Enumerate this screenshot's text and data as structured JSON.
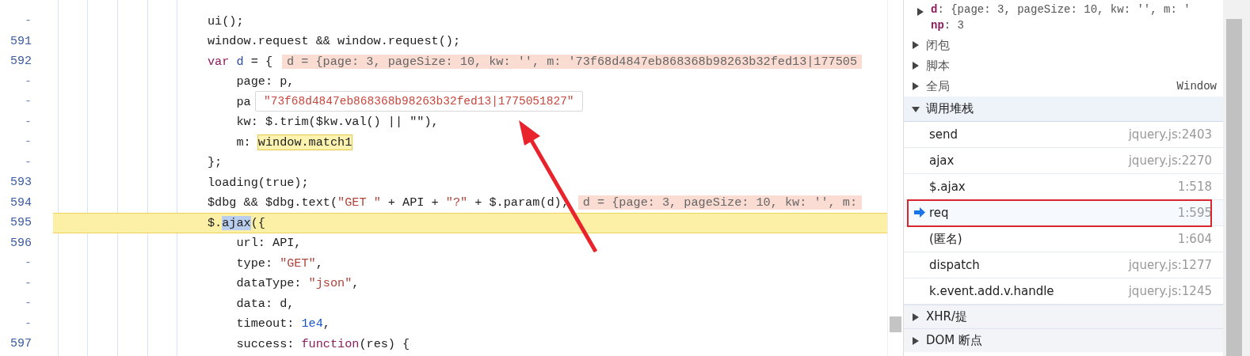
{
  "code_lines": [
    {
      "number": "-",
      "tokens": [
        {
          "text": "ui();",
          "kind": "plain"
        }
      ]
    },
    {
      "number": "591",
      "tokens": [
        {
          "text": "window.request && window.request();",
          "kind": "plain"
        }
      ]
    },
    {
      "number": "592",
      "tokens": [
        {
          "text": "var",
          "kind": "keyword"
        },
        {
          "text": " d",
          "kind": "variable"
        },
        {
          "text": " = {",
          "kind": "plain"
        }
      ],
      "inline_value": "d = {page: 3, pageSize: 10, kw: '', m: '73f68d4847eb868368b98263b32fed13|177505"
    },
    {
      "number": "-",
      "tokens": [
        {
          "text": "    page: p,",
          "kind": "plain"
        }
      ]
    },
    {
      "number": "-",
      "tokens": [
        {
          "text": "    pa",
          "kind": "plain"
        }
      ]
    },
    {
      "number": "-",
      "tokens": [
        {
          "text": "    kw: $.trim($kw.val() || \"\"),",
          "kind": "plain"
        }
      ]
    },
    {
      "number": "-",
      "tokens": [
        {
          "text": "    m: ",
          "kind": "plain"
        },
        {
          "text": "window.match1",
          "kind": "hovered"
        }
      ]
    },
    {
      "number": "-",
      "tokens": [
        {
          "text": "};",
          "kind": "plain"
        }
      ]
    },
    {
      "number": "593",
      "tokens": [
        {
          "text": "loading(true);",
          "kind": "plain"
        }
      ]
    },
    {
      "number": "594",
      "tokens": [
        {
          "text": "$dbg && $dbg.text(",
          "kind": "plain"
        },
        {
          "text": "\"GET \"",
          "kind": "string"
        },
        {
          "text": " + API + ",
          "kind": "plain"
        },
        {
          "text": "\"?\"",
          "kind": "string"
        },
        {
          "text": " + $.param(d);",
          "kind": "plain"
        }
      ],
      "inline_value": "d = {page: 3, pageSize: 10, kw: '', m:"
    },
    {
      "number": "595",
      "current": true,
      "tokens": [
        {
          "text": "$.",
          "kind": "plain"
        },
        {
          "text": "ajax",
          "kind": "selection"
        },
        {
          "text": "({",
          "kind": "plain"
        }
      ]
    },
    {
      "number": "596",
      "tokens": [
        {
          "text": "    url: API,",
          "kind": "plain"
        }
      ]
    },
    {
      "number": "-",
      "tokens": [
        {
          "text": "    type: ",
          "kind": "plain"
        },
        {
          "text": "\"GET\"",
          "kind": "string"
        },
        {
          "text": ",",
          "kind": "plain"
        }
      ]
    },
    {
      "number": "-",
      "tokens": [
        {
          "text": "    dataType: ",
          "kind": "plain"
        },
        {
          "text": "\"json\"",
          "kind": "string"
        },
        {
          "text": ",",
          "kind": "plain"
        }
      ]
    },
    {
      "number": "-",
      "tokens": [
        {
          "text": "    data: d,",
          "kind": "plain"
        }
      ]
    },
    {
      "number": "-",
      "tokens": [
        {
          "text": "    timeout: ",
          "kind": "plain"
        },
        {
          "text": "1e4",
          "kind": "number"
        },
        {
          "text": ",",
          "kind": "plain"
        }
      ]
    },
    {
      "number": "597",
      "tokens": [
        {
          "text": "    success: ",
          "kind": "plain"
        },
        {
          "text": "function",
          "kind": "keyword"
        },
        {
          "text": "(res) {",
          "kind": "plain"
        }
      ]
    }
  ],
  "tooltip": {
    "value": "\"73f68d4847eb868368b98263b32fed13|1775051827\""
  },
  "scope_vars": [
    {
      "name": "d",
      "value": ": {page: 3, pageSize: 10, kw: '', m: '",
      "kind": "object"
    },
    {
      "name": "np",
      "value": ": 3",
      "kind": "primitive"
    }
  ],
  "sections": [
    {
      "label": "闭包",
      "expanded": false
    },
    {
      "label": "脚本",
      "expanded": false
    },
    {
      "label": "全局",
      "expanded": false,
      "value": "Window"
    },
    {
      "label": "调用堆栈",
      "expanded": true
    }
  ],
  "call_stack": [
    {
      "name": "send",
      "location": "jquery.js:2403",
      "selected": false
    },
    {
      "name": "ajax",
      "location": "jquery.js:2270",
      "selected": false
    },
    {
      "name": "$.ajax",
      "location": "1:518",
      "selected": false
    },
    {
      "name": "req",
      "location": "1:595",
      "selected": true
    },
    {
      "name": "(匿名)",
      "location": "1:604",
      "selected": false
    },
    {
      "name": "dispatch",
      "location": "jquery.js:1277",
      "selected": false
    },
    {
      "name": "k.event.add.v.handle",
      "location": "jquery.js:1245",
      "selected": false
    }
  ],
  "lower_sections": [
    {
      "label": "XHR/提",
      "expanded": false
    },
    {
      "label": "DOM 断点",
      "expanded": false
    }
  ]
}
